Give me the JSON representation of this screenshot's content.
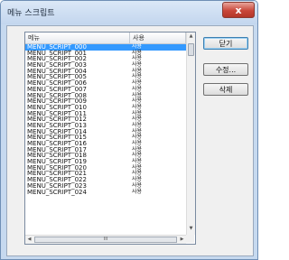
{
  "window": {
    "title": "메뉴 스크립트",
    "close_label": "x"
  },
  "list": {
    "columns": [
      "메뉴",
      "사용"
    ],
    "rows": [
      {
        "name": "MENU_SCRIPT_000",
        "use": "사용"
      },
      {
        "name": "MENU_SCRIPT_001",
        "use": "사용"
      },
      {
        "name": "MENU_SCRIPT_002",
        "use": "사용"
      },
      {
        "name": "MENU_SCRIPT_003",
        "use": "사용"
      },
      {
        "name": "MENU_SCRIPT_004",
        "use": "사용"
      },
      {
        "name": "MENU_SCRIPT_005",
        "use": "사용"
      },
      {
        "name": "MENU_SCRIPT_006",
        "use": "사용"
      },
      {
        "name": "MENU_SCRIPT_007",
        "use": "사용"
      },
      {
        "name": "MENU_SCRIPT_008",
        "use": "사용"
      },
      {
        "name": "MENU_SCRIPT_009",
        "use": "사용"
      },
      {
        "name": "MENU_SCRIPT_010",
        "use": "사용"
      },
      {
        "name": "MENU_SCRIPT_011",
        "use": "사용"
      },
      {
        "name": "MENU_SCRIPT_012",
        "use": "사용"
      },
      {
        "name": "MENU_SCRIPT_013",
        "use": "사용"
      },
      {
        "name": "MENU_SCRIPT_014",
        "use": "사용"
      },
      {
        "name": "MENU_SCRIPT_015",
        "use": "사용"
      },
      {
        "name": "MENU_SCRIPT_016",
        "use": "사용"
      },
      {
        "name": "MENU_SCRIPT_017",
        "use": "사용"
      },
      {
        "name": "MENU_SCRIPT_018",
        "use": "사용"
      },
      {
        "name": "MENU_SCRIPT_019",
        "use": "사용"
      },
      {
        "name": "MENU_SCRIPT_020",
        "use": "사용"
      },
      {
        "name": "MENU_SCRIPT_021",
        "use": "사용"
      },
      {
        "name": "MENU_SCRIPT_022",
        "use": "사용"
      },
      {
        "name": "MENU_SCRIPT_023",
        "use": "사용"
      },
      {
        "name": "MENU_SCRIPT_024",
        "use": "사용"
      }
    ],
    "selected_index": 0,
    "hscroll_thumb_label": "III"
  },
  "buttons": {
    "close": "닫기",
    "edit": "수정...",
    "delete": "삭제"
  },
  "colors": {
    "selection": "#3399ff",
    "close_button": "#c9473a",
    "window_frame": "#c6d9ef"
  }
}
